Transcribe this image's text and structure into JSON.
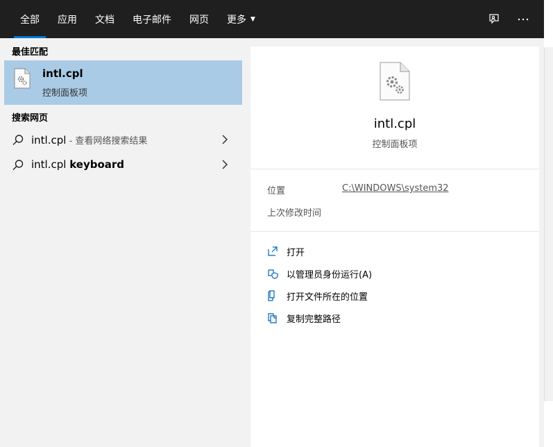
{
  "tabs": [
    {
      "label": "全部",
      "active": true
    },
    {
      "label": "应用"
    },
    {
      "label": "文档"
    },
    {
      "label": "电子邮件"
    },
    {
      "label": "网页"
    },
    {
      "label": "更多"
    }
  ],
  "top_icons": [
    "feedback-icon",
    "more-options-icon"
  ],
  "results": {
    "best_match_title": "最佳匹配",
    "best_match": {
      "name": "intl.cpl",
      "type": "控制面板项"
    },
    "web_title": "搜索网页",
    "web_items": [
      {
        "query": "intl.cpl",
        "hint": " - 查看网络搜索结果",
        "bold": ""
      },
      {
        "query": "intl.cpl ",
        "hint": "",
        "bold": "keyboard"
      }
    ]
  },
  "detail": {
    "name": "intl.cpl",
    "type": "控制面板项",
    "location_label": "位置",
    "location_value": "C:\\WINDOWS\\system32",
    "modified_label": "上次修改时间",
    "actions": [
      {
        "label": "打开",
        "icon": "open-icon"
      },
      {
        "label": "以管理员身份运行(A)",
        "icon": "shield-icon"
      },
      {
        "label": "打开文件所在的位置",
        "icon": "file-location-icon"
      },
      {
        "label": "复制完整路径",
        "icon": "copy-icon"
      }
    ]
  },
  "colors": {
    "accent": "#0078d7",
    "selected": "#aacbe6",
    "topbar": "#1f1f1f"
  }
}
